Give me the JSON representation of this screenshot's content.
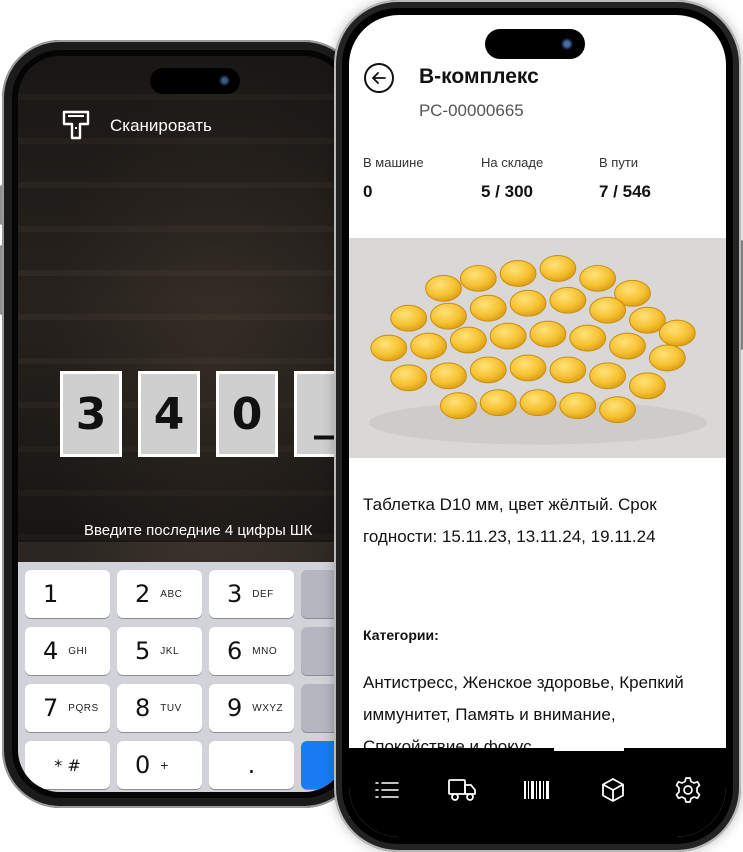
{
  "scanner": {
    "scan_label": "Сканировать",
    "digits": [
      "3",
      "4",
      "0",
      "_"
    ],
    "hint": "Введите последние 4 цифры ШК",
    "keypad": [
      {
        "num": "1",
        "sub": ""
      },
      {
        "num": "2",
        "sub": "ABC"
      },
      {
        "num": "3",
        "sub": "DEF"
      },
      {
        "num": "4",
        "sub": "GHI"
      },
      {
        "num": "5",
        "sub": "JKL"
      },
      {
        "num": "6",
        "sub": "MNO"
      },
      {
        "num": "7",
        "sub": "PQRS"
      },
      {
        "num": "8",
        "sub": "TUV"
      },
      {
        "num": "9",
        "sub": "WXYZ"
      },
      {
        "num": "* #",
        "sub": ""
      },
      {
        "num": "0",
        "sub": "+"
      },
      {
        "num": ".",
        "sub": ""
      }
    ]
  },
  "product": {
    "title": "В-комплекс",
    "code": "РС-00000665",
    "stats": [
      {
        "label": "В машине",
        "value": "0"
      },
      {
        "label": "На складе",
        "value": "5 / 300"
      },
      {
        "label": "В пути",
        "value": "7 / 546"
      }
    ],
    "description": "Таблетка D10 мм, цвет жёлтый. Срок годности: 15.11.23, 13.11.24, 19.11.24",
    "categories_label": "Категории:",
    "categories_text": "Антистресс, Женское здоровье, Крепкий иммунитет, Память и внимание, Спокойствие и фокус"
  },
  "tabbar": {
    "icons": [
      "list-icon",
      "truck-icon",
      "barcode-icon",
      "box-icon",
      "settings-icon"
    ]
  },
  "colors": {
    "accent": "#1a7cf5",
    "pill": "#f4c23a"
  }
}
